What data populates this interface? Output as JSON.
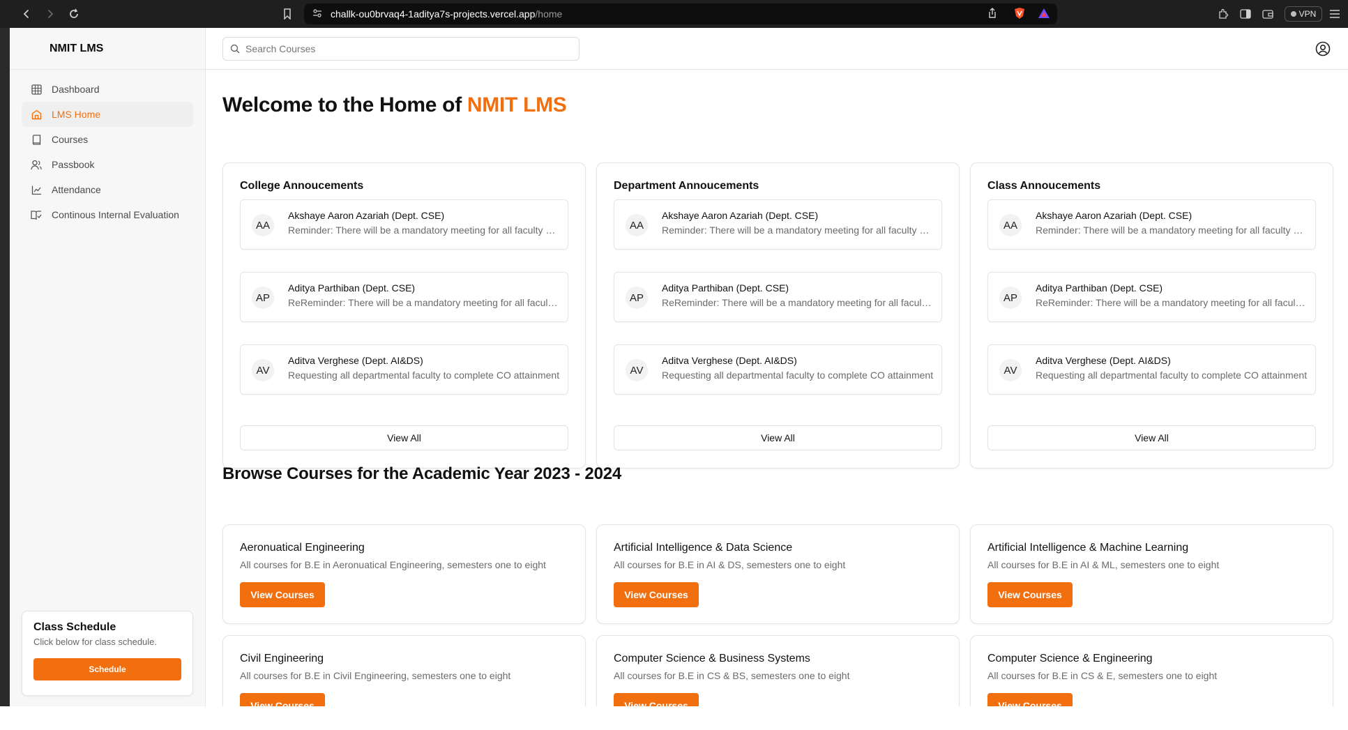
{
  "browser": {
    "url_host": "challk-ou0brvaq4-1aditya7s-projects.vercel.app",
    "url_path": "/home",
    "vpn_label": "VPN"
  },
  "sidebar": {
    "brand": "NMIT LMS",
    "items": [
      {
        "label": "Dashboard",
        "icon": "grid-icon"
      },
      {
        "label": "LMS Home",
        "icon": "home-icon"
      },
      {
        "label": "Courses",
        "icon": "book-icon"
      },
      {
        "label": "Passbook",
        "icon": "users-icon"
      },
      {
        "label": "Attendance",
        "icon": "line-chart-icon"
      },
      {
        "label": "Continous Internal Evaluation",
        "icon": "book-open-icon"
      }
    ],
    "schedule": {
      "title": "Class Schedule",
      "subtitle": "Click below for class schedule.",
      "button": "Schedule"
    }
  },
  "topbar": {
    "search_placeholder": "Search Courses"
  },
  "main": {
    "heading_prefix": "Welcome to the Home of ",
    "heading_accent": "NMIT LMS",
    "announcement_cards": [
      {
        "title": "College Annoucements",
        "items": [
          {
            "initials": "AA",
            "name": "Akshaye Aaron Azariah (Dept. CSE)",
            "message": "Reminder: There will be a mandatory meeting for all faculty members"
          },
          {
            "initials": "AP",
            "name": "Aditya Parthiban (Dept. CSE)",
            "message": "ReReminder: There will be a mandatory meeting for all faculty members"
          },
          {
            "initials": "AV",
            "name": "Aditva Verghese (Dept. AI&DS)",
            "message": "Requesting all departmental faculty to complete CO attainment"
          }
        ],
        "view_all": "View All"
      },
      {
        "title": "Department Annoucements",
        "items": [
          {
            "initials": "AA",
            "name": "Akshaye Aaron Azariah (Dept. CSE)",
            "message": "Reminder: There will be a mandatory meeting for all faculty members"
          },
          {
            "initials": "AP",
            "name": "Aditya Parthiban (Dept. CSE)",
            "message": "ReReminder: There will be a mandatory meeting for all faculty members"
          },
          {
            "initials": "AV",
            "name": "Aditva Verghese (Dept. AI&DS)",
            "message": "Requesting all departmental faculty to complete CO attainment"
          }
        ],
        "view_all": "View All"
      },
      {
        "title": "Class Annoucements",
        "items": [
          {
            "initials": "AA",
            "name": "Akshaye Aaron Azariah (Dept. CSE)",
            "message": "Reminder: There will be a mandatory meeting for all faculty members"
          },
          {
            "initials": "AP",
            "name": "Aditya Parthiban (Dept. CSE)",
            "message": "ReReminder: There will be a mandatory meeting for all faculty members"
          },
          {
            "initials": "AV",
            "name": "Aditva Verghese (Dept. AI&DS)",
            "message": "Requesting all departmental faculty to complete CO attainment"
          }
        ],
        "view_all": "View All"
      }
    ],
    "courses_heading": "Browse Courses for the Academic Year 2023 - 2024",
    "courses": [
      {
        "title": "Aeronuatical Engineering",
        "desc": "All courses for B.E in Aeronuatical Engineering, semesters one to eight",
        "button": "View Courses"
      },
      {
        "title": "Artificial Intelligence & Data Science",
        "desc": "All courses for B.E in AI & DS, semesters one to eight",
        "button": "View Courses"
      },
      {
        "title": "Artificial Intelligence & Machine Learning",
        "desc": "All courses for B.E in AI & ML, semesters one to eight",
        "button": "View Courses"
      },
      {
        "title": "Civil Engineering",
        "desc": "All courses for B.E in Civil Engineering, semesters one to eight",
        "button": "View Courses"
      },
      {
        "title": "Computer Science & Business Systems",
        "desc": "All courses for B.E in CS & BS, semesters one to eight",
        "button": "View Courses"
      },
      {
        "title": "Computer Science & Engineering",
        "desc": "All courses for B.E in CS & E, semesters one to eight",
        "button": "View Courses"
      }
    ]
  },
  "colors": {
    "accent": "#f26f0f",
    "sidebar_bg": "#f7f7f7",
    "chrome_bg": "#1f1f1f"
  }
}
